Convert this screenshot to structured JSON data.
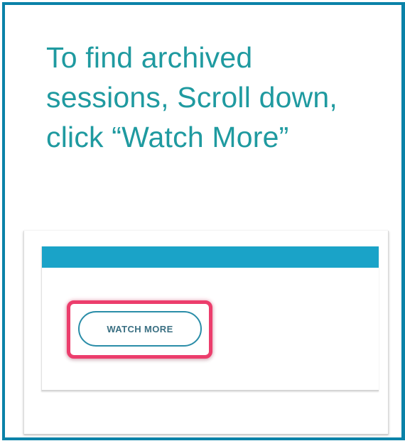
{
  "instruction": {
    "text": "To find archived sessions, Scroll down, click “Watch More”"
  },
  "inset": {
    "button_label": "WATCH MORE"
  },
  "colors": {
    "frame_border": "#0a82a8",
    "instruction_text": "#1f9aa0",
    "header_bar": "#1aa3c8",
    "highlight": "#ec3d6c",
    "button_border": "#2a8da8"
  }
}
